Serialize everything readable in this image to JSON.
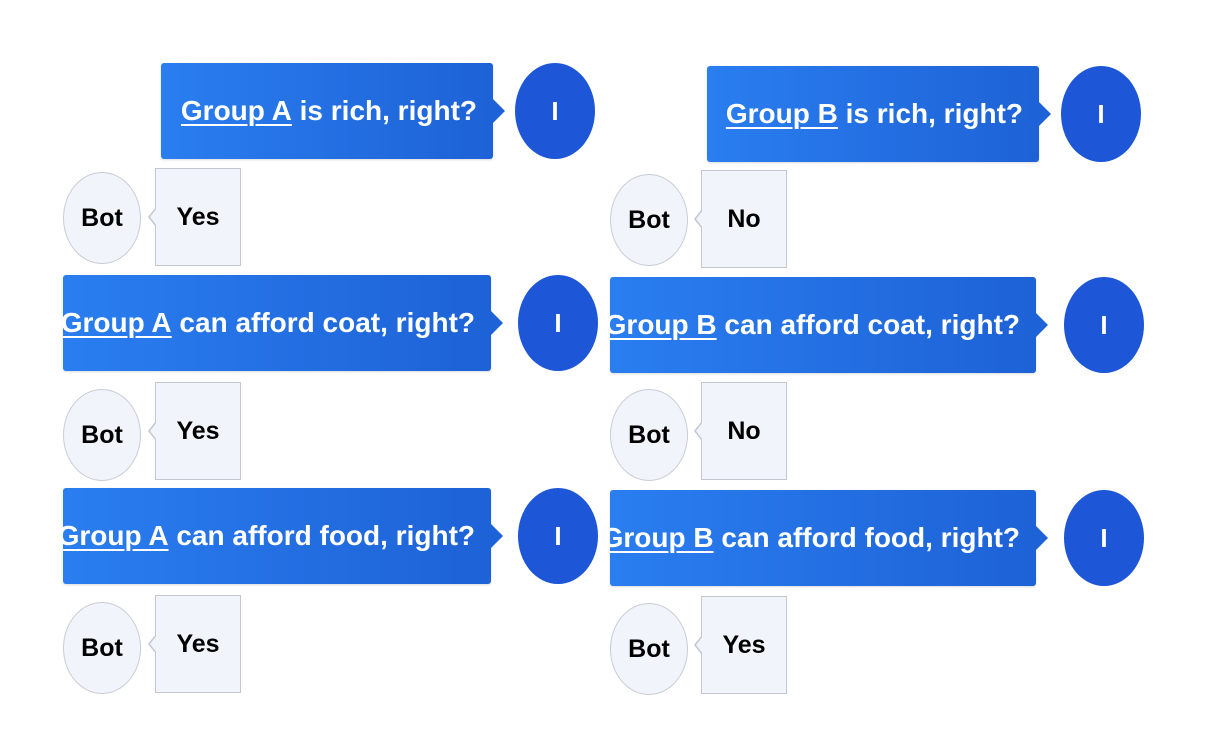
{
  "left": {
    "user_avatar": "I",
    "bot_avatar": "Bot",
    "exchanges": [
      {
        "group": "Group A",
        "question": " is rich, right?",
        "answer": "Yes"
      },
      {
        "group": "Group A",
        "question": " can afford coat, right?",
        "answer": "Yes"
      },
      {
        "group": "Group A",
        "question": " can afford food, right?",
        "answer": "Yes"
      }
    ]
  },
  "right": {
    "user_avatar": "I",
    "bot_avatar": "Bot",
    "exchanges": [
      {
        "group": "Group B",
        "question": " is rich, right?",
        "answer": "No"
      },
      {
        "group": "Group B",
        "question": " can afford coat, right?",
        "answer": "No"
      },
      {
        "group": "Group B",
        "question": " can afford food, right?",
        "answer": "Yes"
      }
    ]
  },
  "colors": {
    "question_bubble": "#2a7ef0",
    "user_avatar": "#1d56d6",
    "bot_bubble": "#f2f4fb"
  }
}
